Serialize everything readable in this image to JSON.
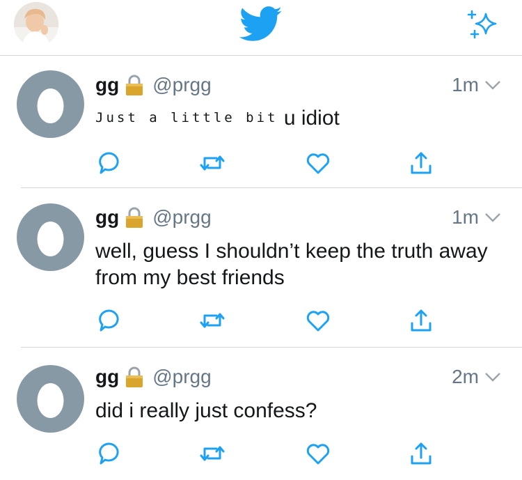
{
  "header": {
    "avatar_icon": "profile-photo",
    "logo_icon": "twitter-bird-icon",
    "sparkle_icon": "sparkle-icon",
    "brand_color": "#1da1f2"
  },
  "tweets": [
    {
      "name": "gg",
      "handle": "@prgg",
      "time": "1m",
      "text_glitch": "Just a little bit",
      "text": "u idiot"
    },
    {
      "name": "gg",
      "handle": "@prgg",
      "time": "1m",
      "text": "well, guess I shouldn’t keep the truth away from my best friends"
    },
    {
      "name": "gg",
      "handle": "@prgg",
      "time": "2m",
      "text": "did i really just confess?"
    }
  ],
  "colors": {
    "text": "#14171a",
    "muted": "#657786",
    "action_icons": "#1da1f2",
    "egg_avatar": "#8899a6",
    "divider": "#d5d5d5"
  }
}
